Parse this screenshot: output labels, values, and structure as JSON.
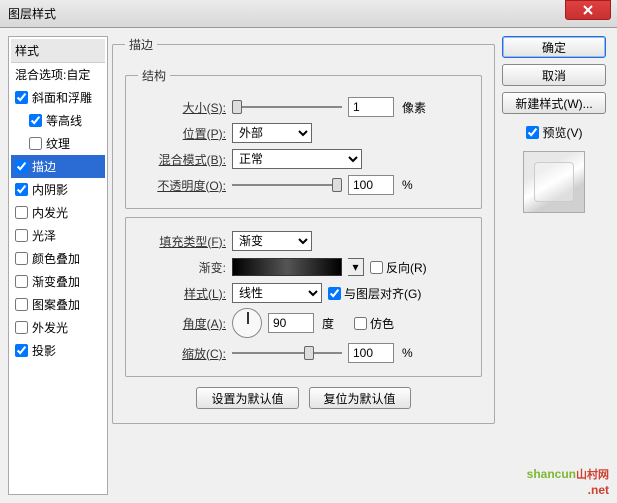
{
  "title": "图层样式",
  "sidebar": {
    "header": "样式",
    "blend": "混合选项:自定",
    "items": [
      {
        "label": "斜面和浮雕",
        "checked": true,
        "sel": false,
        "indent": false
      },
      {
        "label": "等高线",
        "checked": true,
        "sel": false,
        "indent": true
      },
      {
        "label": "纹理",
        "checked": false,
        "sel": false,
        "indent": true
      },
      {
        "label": "描边",
        "checked": true,
        "sel": true,
        "indent": false
      },
      {
        "label": "内阴影",
        "checked": true,
        "sel": false,
        "indent": false
      },
      {
        "label": "内发光",
        "checked": false,
        "sel": false,
        "indent": false
      },
      {
        "label": "光泽",
        "checked": false,
        "sel": false,
        "indent": false
      },
      {
        "label": "颜色叠加",
        "checked": false,
        "sel": false,
        "indent": false
      },
      {
        "label": "渐变叠加",
        "checked": false,
        "sel": false,
        "indent": false
      },
      {
        "label": "图案叠加",
        "checked": false,
        "sel": false,
        "indent": false
      },
      {
        "label": "外发光",
        "checked": false,
        "sel": false,
        "indent": false
      },
      {
        "label": "投影",
        "checked": true,
        "sel": false,
        "indent": false
      }
    ]
  },
  "panel": {
    "title": "描边",
    "struct": {
      "legend": "结构",
      "size_label": "大小(S):",
      "size_value": "1",
      "size_unit": "像素",
      "pos_label": "位置(P):",
      "pos_value": "外部",
      "blend_label": "混合模式(B):",
      "blend_value": "正常",
      "opacity_label": "不透明度(O):",
      "opacity_value": "100",
      "opacity_unit": "%"
    },
    "fill": {
      "type_label": "填充类型(F):",
      "type_value": "渐变",
      "grad_label": "渐变:",
      "reverse_label": "反向(R)",
      "reverse_checked": false,
      "style_label": "样式(L):",
      "style_value": "线性",
      "align_label": "与图层对齐(G)",
      "align_checked": true,
      "angle_label": "角度(A):",
      "angle_value": "90",
      "angle_unit": "度",
      "dither_label": "仿色",
      "dither_checked": false,
      "scale_label": "缩放(C):",
      "scale_value": "100",
      "scale_unit": "%"
    },
    "defaults": {
      "set": "设置为默认值",
      "reset": "复位为默认值"
    }
  },
  "right": {
    "ok": "确定",
    "cancel": "取消",
    "newstyle": "新建样式(W)...",
    "preview_label": "预览(V)",
    "preview_checked": true
  },
  "watermark": {
    "main": "shancun",
    "sub": "山村网",
    "ext": ".net"
  }
}
